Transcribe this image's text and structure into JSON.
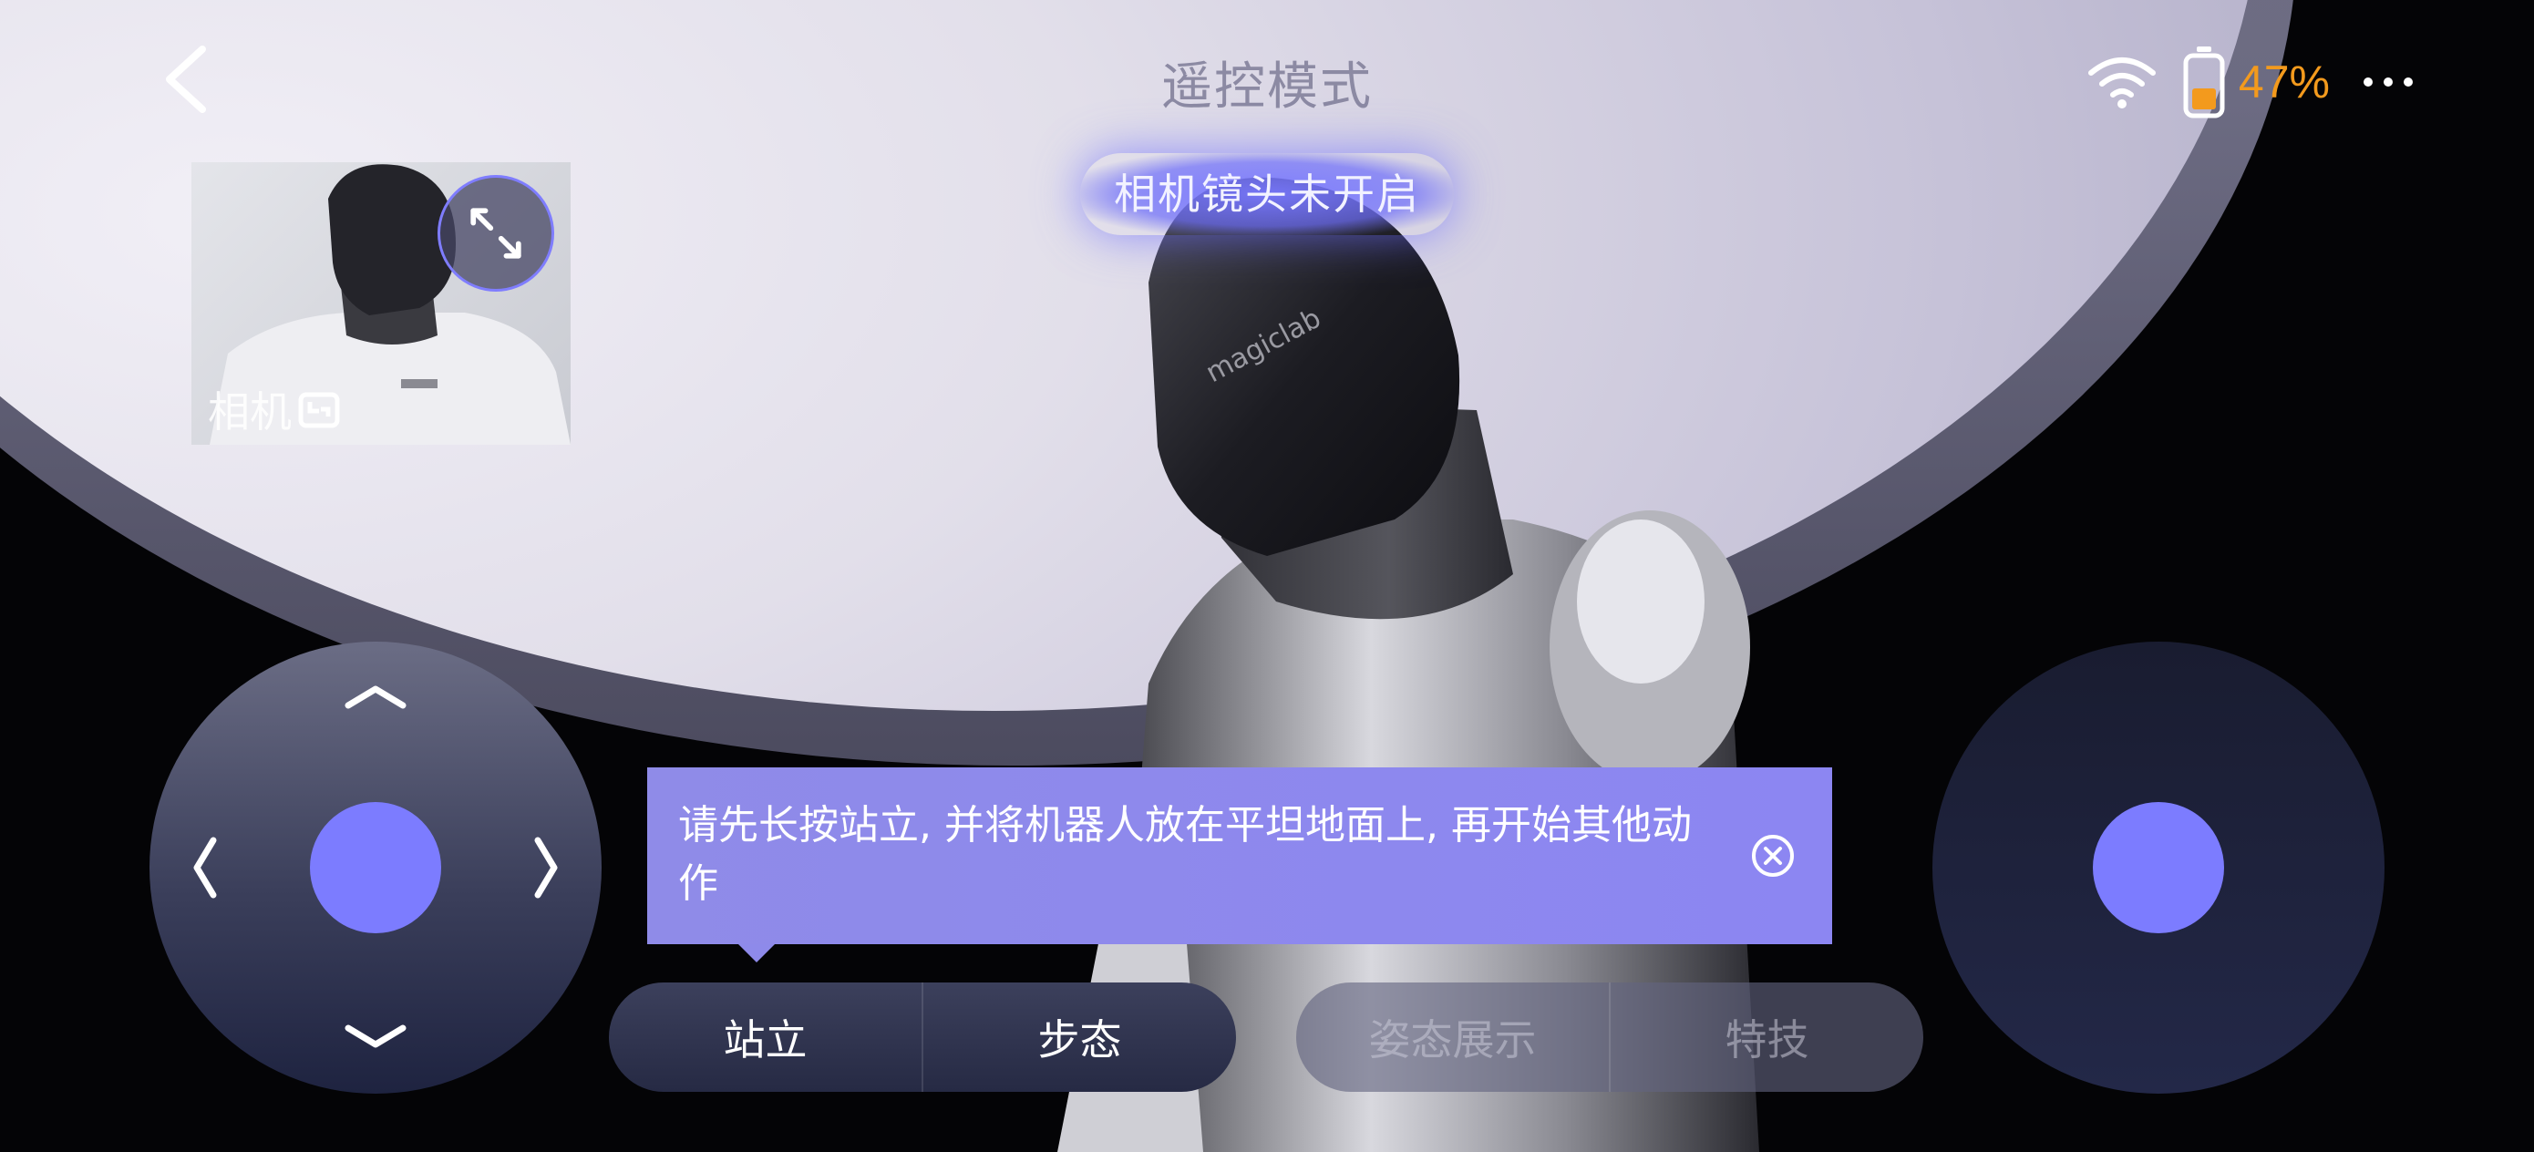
{
  "header": {
    "title": "遥控模式",
    "battery_percent": "47%"
  },
  "camera": {
    "status_text": "相机镜头未开启",
    "thumbnail_label": "相机"
  },
  "tip": {
    "message": "请先长按站立, 并将机器人放在平坦地面上, 再开始其他动作"
  },
  "modes": {
    "stand": "站立",
    "gait": "步态",
    "pose_show": "姿态展示",
    "stunt": "特技"
  },
  "colors": {
    "accent": "#7c7cff",
    "battery": "#f39a1d"
  },
  "icons": [
    "back-icon",
    "wifi-icon",
    "battery-icon",
    "more-icon",
    "expand-icon",
    "camera-switch-icon",
    "close-icon",
    "arrow-up-icon",
    "arrow-down-icon",
    "arrow-left-icon",
    "arrow-right-icon"
  ]
}
